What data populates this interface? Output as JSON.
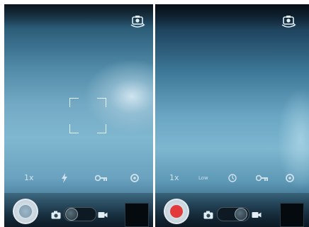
{
  "left_screen": {
    "mode": "photo",
    "settings": {
      "zoom_label": "1x"
    },
    "icons": [
      "switch-camera-icon",
      "flash-icon",
      "white-balance-icon",
      "settings-icon",
      "camera-icon",
      "video-icon"
    ]
  },
  "right_screen": {
    "mode": "video",
    "settings": {
      "zoom_label": "1x",
      "quality_label": "Low"
    },
    "icons": [
      "switch-camera-icon",
      "timer-icon",
      "white-balance-icon",
      "settings-icon",
      "camera-icon",
      "video-icon"
    ]
  },
  "colors": {
    "record_red": "#e23a3a",
    "ui_white": "#e3eef4"
  }
}
